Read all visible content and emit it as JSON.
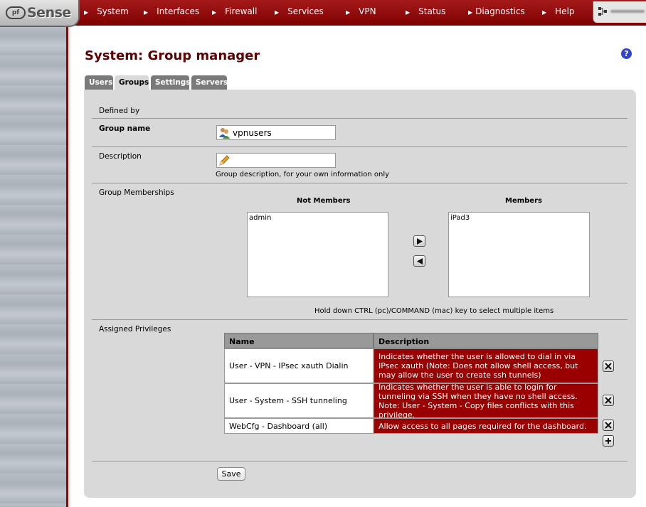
{
  "header": {
    "logo_mark": "pf",
    "logo_text": "Sense",
    "nav": [
      "System",
      "Interfaces",
      "Firewall",
      "Services",
      "VPN",
      "Status",
      "Diagnostics",
      "Help"
    ]
  },
  "page": {
    "title": "System: Group manager",
    "help": "?"
  },
  "tabs": [
    {
      "label": "Users",
      "active": false
    },
    {
      "label": "Groups",
      "active": true
    },
    {
      "label": "Settings",
      "active": false
    },
    {
      "label": "Servers",
      "active": false
    }
  ],
  "form": {
    "defined_by_label": "Defined by",
    "group_name_label": "Group name",
    "group_name_value": "vpnusers",
    "description_label": "Description",
    "description_value": "",
    "description_hint": "Group description, for your own information only",
    "memberships_label": "Group Memberships",
    "not_members_heading": "Not Members",
    "members_heading": "Members",
    "not_members": [
      "admin"
    ],
    "members": [
      "iPad3"
    ],
    "select_hint": "Hold down CTRL (pc)/COMMAND (mac) key to select multiple items",
    "privileges_label": "Assigned Privileges",
    "privileges_headers": {
      "name": "Name",
      "description": "Description"
    },
    "privileges": [
      {
        "name": "User - VPN - IPsec xauth Dialin",
        "description": "Indicates whether the user is allowed to dial in via IPsec xauth (Note: Does not allow shell access, but may allow the user to create ssh tunnels)"
      },
      {
        "name": "User - System - SSH tunneling",
        "description": "Indicates whether the user is able to login for tunneling via SSH when they have no shell access. Note: User - System - Copy files conflicts with this privilege."
      },
      {
        "name": "WebCfg - Dashboard (all)",
        "description": "Allow access to all pages required for the dashboard."
      }
    ],
    "save_label": "Save"
  },
  "colors": {
    "brand_red": "#990000",
    "panel_gray": "#d9d9d9"
  }
}
